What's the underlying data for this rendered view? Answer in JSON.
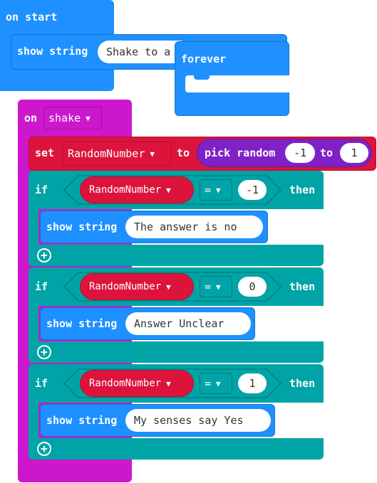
{
  "on_start": {
    "label": "on start",
    "show_string": {
      "label": "show string",
      "value": "Shake to a"
    }
  },
  "forever": {
    "label": "forever"
  },
  "on_shake": {
    "label": "on",
    "gesture": "shake",
    "set_block": {
      "label": "set",
      "variable": "RandomNumber",
      "to_label": "to",
      "pick_random": {
        "label": "pick random",
        "from": "-1",
        "to_label": "to",
        "to": "1"
      }
    },
    "if_blocks": [
      {
        "if_label": "if",
        "variable": "RandomNumber",
        "operator": "=",
        "value": "-1",
        "then_label": "then",
        "show_label": "show string",
        "message": "The answer is no"
      },
      {
        "if_label": "if",
        "variable": "RandomNumber",
        "operator": "=",
        "value": "0",
        "then_label": "then",
        "show_label": "show string",
        "message": "Answer Unclear"
      },
      {
        "if_label": "if",
        "variable": "RandomNumber",
        "operator": "=",
        "value": "1",
        "then_label": "then",
        "show_label": "show string",
        "message": "My senses say Yes"
      }
    ]
  },
  "colors": {
    "basic": "#1e90ff",
    "input": "#cc17cc",
    "variables": "#dc143c",
    "logic": "#00a4a6",
    "math": "#7f21c6"
  },
  "icons": {
    "add": "plus-circle-icon",
    "dropdown": "caret-down-icon"
  }
}
